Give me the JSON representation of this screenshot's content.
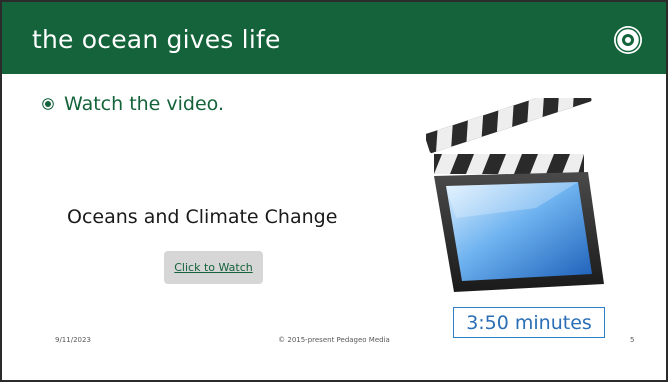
{
  "slide": {
    "title": "the ocean gives life",
    "bullet": "Watch the video.",
    "video_title": "Oceans and Climate Change",
    "watch_label": "Click to Watch",
    "duration": "3:50 minutes",
    "logo_icon": "school-seal-logo",
    "media_icon": "clapperboard-icon"
  },
  "footer": {
    "date": "9/11/2023",
    "copyright": "© 2015-present Pedageo Media",
    "page": "5"
  },
  "colors": {
    "header": "#14633a",
    "accent_text": "#14633a",
    "duration_border": "#2f7fc1",
    "duration_text": "#2a6fb5"
  }
}
